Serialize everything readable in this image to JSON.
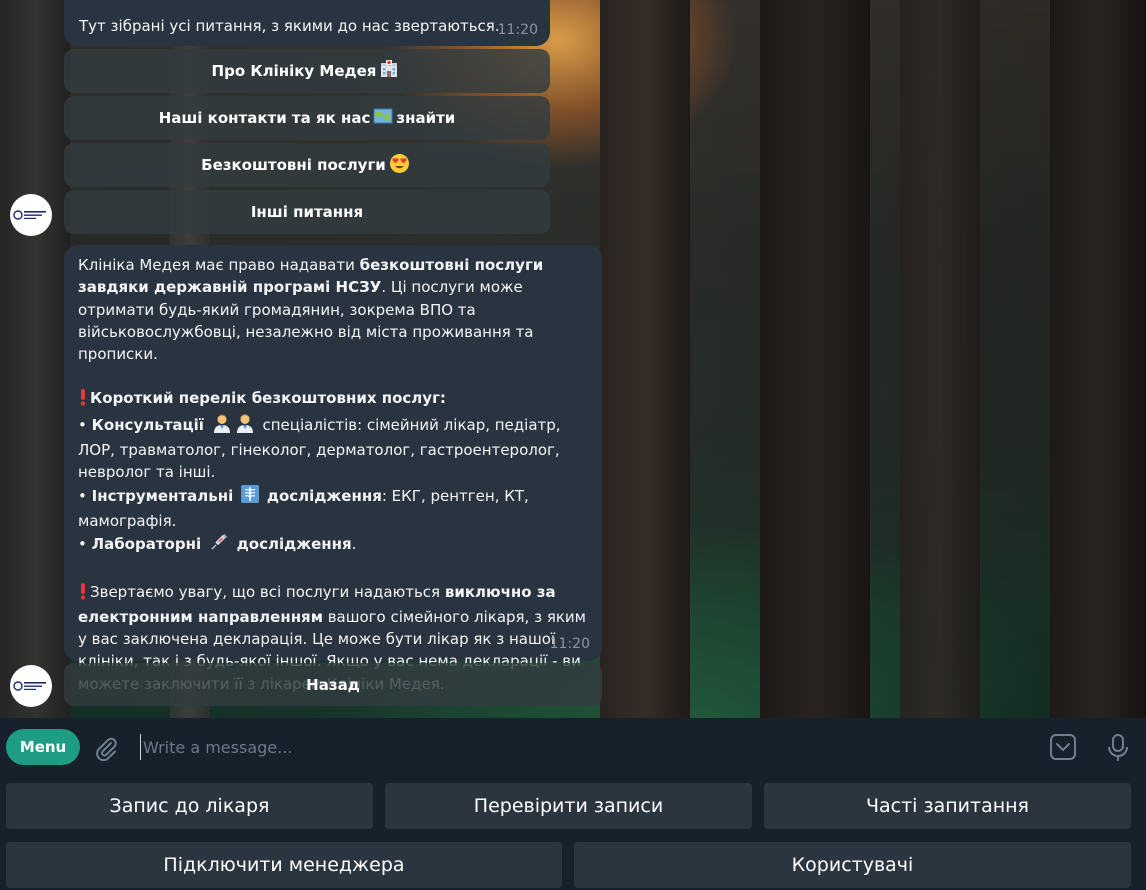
{
  "chat": {
    "intro_message": {
      "text": "Тут зібрані усі питання, з якими до нас звертаються.",
      "time": "11:20"
    },
    "inline_buttons": [
      {
        "label": "Про Клініку Медея",
        "emoji": "hospital"
      },
      {
        "label_before": "Наші контакти та як нас",
        "emoji": "map",
        "label_after": "знайти"
      },
      {
        "label": "Безкоштовні послуги",
        "emoji": "heart-eyes"
      },
      {
        "label": "Інші питання"
      }
    ],
    "info_message": {
      "p1_plain1": "Клініка Медея має право надавати ",
      "p1_bold": "безкоштовні послуги завдяки державній програмі НСЗУ",
      "p1_plain2": ". Ці послуги може отримати будь-який громадянин, зокрема ВПО та військовослужбовці, незалежно від міста проживання та прописки.",
      "list_title": "Короткий перелік безкоштовних послуг:",
      "item1_bold": "Консультації",
      "item1_rest": "спеціалістів: сімейний лікар, педіатр, ЛОР, травматолог, гінеколог, дерматолог, гастроентеролог, невролог та інші.",
      "item2_bold_a": "Інструментальні",
      "item2_bold_b": "дослідження",
      "item2_rest": ": ЕКГ, рентген, КТ, мамографія.",
      "item3_bold_a": "Лабораторні",
      "item3_bold_b": "дослідження",
      "item3_rest": ".",
      "note_plain1": "Звертаємо увагу, що всі послуги надаються ",
      "note_bold": "виключно за електронним направленням",
      "note_plain2": " вашого сімейного лікаря, з яким у вас заключена декларація. Це може бути лікар як з нашої клініки, так і з будь-якої іншої. Якщо у вас нема декларації - ви можете заключити її з лікарем Клініки Медея.",
      "time": "11:20"
    },
    "back_button": "Назад"
  },
  "input": {
    "menu_label": "Menu",
    "placeholder": "Write a message..."
  },
  "reply_keyboard": {
    "row1": [
      "Запис до лікаря",
      "Перевірити записи",
      "Часті запитання"
    ],
    "row2": [
      "Підключити менеджера",
      "Користувачі"
    ]
  },
  "colors": {
    "bubble": "#2a3440",
    "menu_accent": "#1f9c84",
    "panel": "#17212b",
    "reply_button": "#2b3540"
  }
}
